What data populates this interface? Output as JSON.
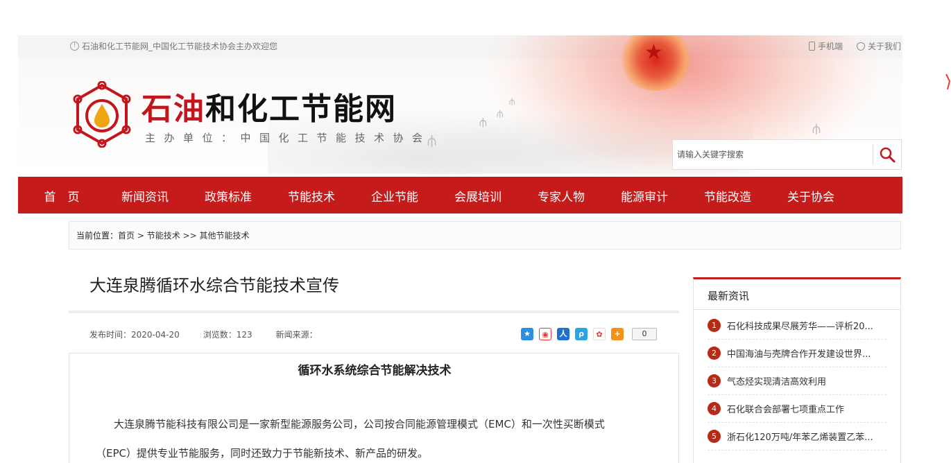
{
  "topbar": {
    "welcome": "石油和化工节能网_中国化工节能技术协会主办欢迎您",
    "mobile": "手机端",
    "about": "关于我们"
  },
  "site": {
    "name_red": "石油",
    "name_black": "和化工节能网",
    "subtitle": "主办单位：中国化工节能技术协会"
  },
  "search": {
    "placeholder": "请输入关键字搜索"
  },
  "nav": [
    "首　页",
    "新闻资讯",
    "政策标准",
    "节能技术",
    "企业节能",
    "会展培训",
    "专家人物",
    "能源审计",
    "节能改造",
    "关于协会"
  ],
  "breadcrumb": {
    "label": "当前位置：",
    "home": "首页",
    "sep1": " > ",
    "level1": "节能技术",
    "sep2": " >> ",
    "level2": "其他节能技术"
  },
  "article": {
    "title": "大连泉腾循环水综合节能技术宣传",
    "publish_time": "发布时间：2020-04-20",
    "views": "浏览数：123",
    "source": "新闻来源：",
    "share_count": "0",
    "heading": "循环水系统综合节能解决技术",
    "para_line1": "大连泉腾节能科技有限公司是一家新型能源服务公司，公司按合同能源管理模式（EMC）和一次性买断模式",
    "para_line2": "（EPC）提供专业节能服务，同时还致力于节能新技术、新产品的研发。"
  },
  "sidebar": {
    "title": "最新资讯",
    "items": [
      {
        "num": "1",
        "text": "石化科技成果尽展芳华——评析20..."
      },
      {
        "num": "2",
        "text": "中国海油与壳牌合作开发建设世界..."
      },
      {
        "num": "3",
        "text": "气态烃实现清洁高效利用"
      },
      {
        "num": "4",
        "text": "石化联合会部署七项重点工作"
      },
      {
        "num": "5",
        "text": "浙石化120万吨/年苯乙烯装置乙苯..."
      }
    ]
  },
  "colors": {
    "brand_red": "#c51b1a",
    "title_red": "#c3161c",
    "badge_red": "#b82a18"
  }
}
